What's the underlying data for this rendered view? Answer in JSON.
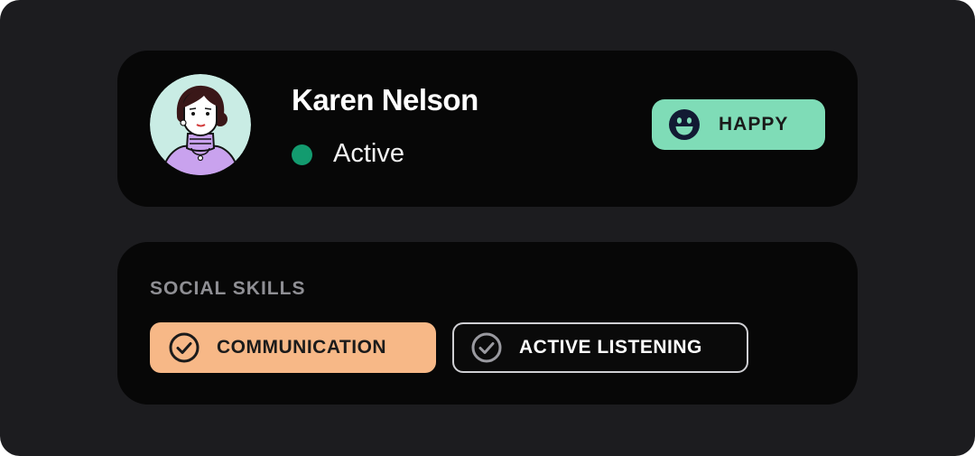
{
  "profile": {
    "name": "Karen Nelson",
    "status": "Active",
    "status_color": "#139b6f",
    "avatar_bg": "#c9ece4",
    "avatar_icon": "woman-avatar-icon"
  },
  "mood": {
    "label": "HAPPY",
    "icon": "smiley-face-icon",
    "bg_color": "#7fdcb7",
    "icon_color": "#121a33"
  },
  "skills": {
    "title": "SOCIAL SKILLS",
    "items": [
      {
        "label": "COMMUNICATION",
        "icon": "check-circle-icon",
        "style": "filled",
        "bg_color": "#f7b887",
        "text_color": "#1b1b1b"
      },
      {
        "label": "ACTIVE LISTENING",
        "icon": "check-circle-icon",
        "style": "outlined",
        "bg_color": "#0a0a0a",
        "text_color": "#ffffff"
      }
    ]
  },
  "colors": {
    "page_bg": "#1c1c1f",
    "card_bg": "#070707"
  }
}
